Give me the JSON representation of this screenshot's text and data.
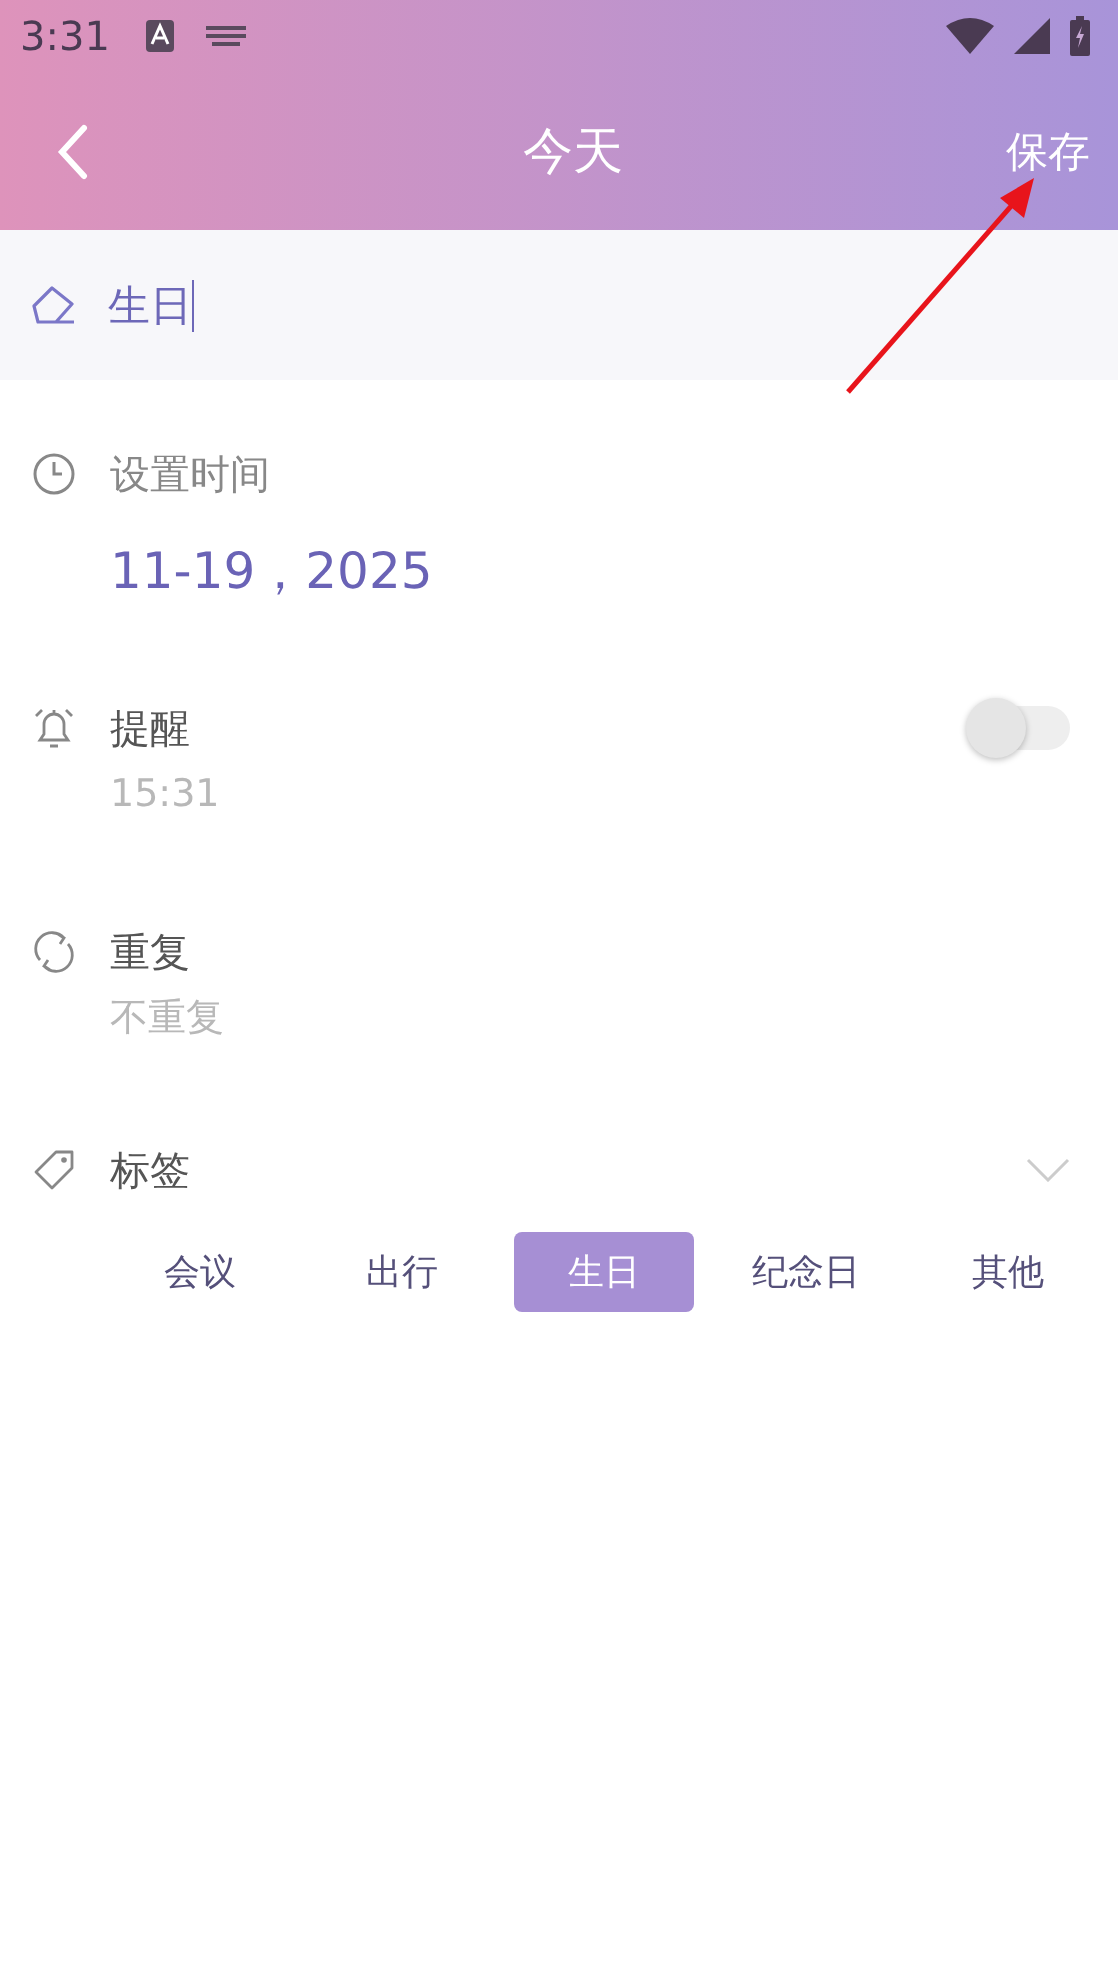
{
  "status_bar": {
    "time": "3:31"
  },
  "header": {
    "title": "今天",
    "action": "保存"
  },
  "title_field": {
    "value": "生日"
  },
  "time": {
    "label": "设置时间",
    "value": "11-19，2025"
  },
  "reminder": {
    "label": "提醒",
    "time": "15:31",
    "on": false
  },
  "repeat": {
    "label": "重复",
    "value": "不重复"
  },
  "tags": {
    "label": "标签",
    "items": [
      {
        "label": "会议",
        "selected": false
      },
      {
        "label": "出行",
        "selected": false
      },
      {
        "label": "生日",
        "selected": true
      },
      {
        "label": "纪念日",
        "selected": false
      },
      {
        "label": "其他",
        "selected": false
      }
    ]
  }
}
